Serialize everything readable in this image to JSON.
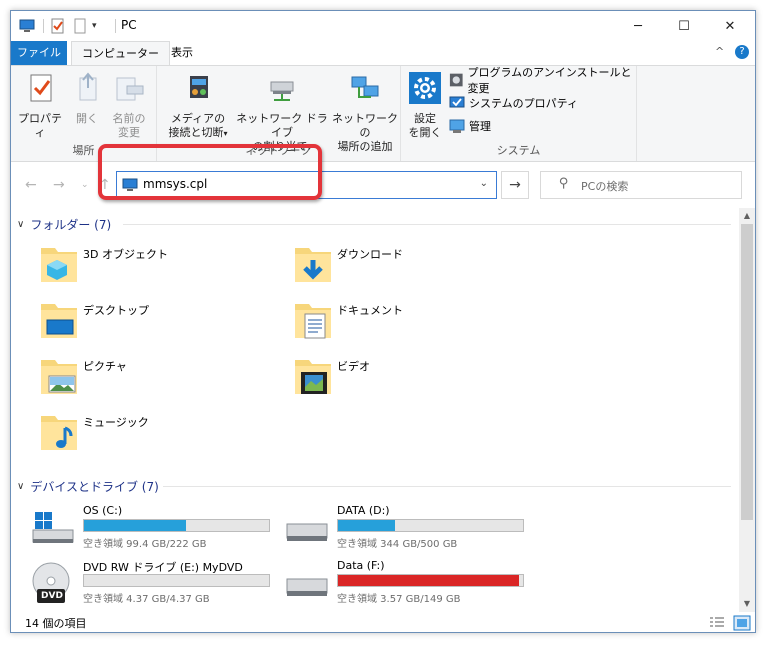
{
  "window": {
    "title": "PC",
    "minimize_glyph": "─",
    "maximize_glyph": "☐",
    "close_glyph": "✕"
  },
  "tabs": {
    "file": "ファイル",
    "computer": "コンピューター",
    "view": "表示",
    "collapse_glyph": "^",
    "help_glyph": "?"
  },
  "ribbon": {
    "location": {
      "label": "場所",
      "properties": "プロパティ",
      "open": "開く",
      "rename_line1": "名前の",
      "rename_line2": "変更"
    },
    "network": {
      "label": "ネットワーク",
      "media_line1": "メディアの",
      "media_line2": "接続と切断",
      "map_line1": "ネットワーク ドライブ",
      "map_line2": "の割り当て",
      "add_line1": "ネットワークの",
      "add_line2": "場所の追加"
    },
    "system": {
      "label": "システム",
      "settings_line1": "設定",
      "settings_line2": "を開く",
      "uninstall": "プログラムのアンインストールと変更",
      "sysprops": "システムのプロパティ",
      "manage": "管理"
    }
  },
  "nav": {
    "address_value": "mmsys.cpl",
    "search_placeholder": "PCの検索"
  },
  "folders_section": {
    "header": "フォルダー (7)",
    "items": [
      {
        "name": "3D オブジェクト",
        "icon": "3d-objects-folder-icon"
      },
      {
        "name": "ダウンロード",
        "icon": "downloads-folder-icon"
      },
      {
        "name": "デスクトップ",
        "icon": "desktop-folder-icon"
      },
      {
        "name": "ドキュメント",
        "icon": "documents-folder-icon"
      },
      {
        "name": "ピクチャ",
        "icon": "pictures-folder-icon"
      },
      {
        "name": "ビデオ",
        "icon": "videos-folder-icon"
      },
      {
        "name": "ミュージック",
        "icon": "music-folder-icon"
      }
    ]
  },
  "drives_section": {
    "header": "デバイスとドライブ (7)",
    "items": [
      {
        "name": "OS (C:)",
        "free": "空き領域 99.4 GB/222 GB",
        "used_fraction": 0.55,
        "icon": "windows-drive-icon"
      },
      {
        "name": "DATA (D:)",
        "free": "空き領域 344 GB/500 GB",
        "used_fraction": 0.31,
        "icon": "hard-drive-icon"
      },
      {
        "name": "DVD RW ドライブ (E:) MyDVD",
        "free": "空き領域 4.37 GB/4.37 GB",
        "used_fraction": 0.0,
        "icon": "dvd-drive-icon",
        "dvd_label": "DVD"
      },
      {
        "name": "Data (F:)",
        "free": "空き領域 3.57 GB/149 GB",
        "used_fraction": 0.976,
        "icon": "hard-drive-icon"
      }
    ]
  },
  "status": {
    "items_count": "14 個の項目"
  },
  "colors": {
    "accent": "#1979ca",
    "bar_normal": "#26a0da",
    "bar_full": "#da2626",
    "highlight": "#e3343a"
  }
}
